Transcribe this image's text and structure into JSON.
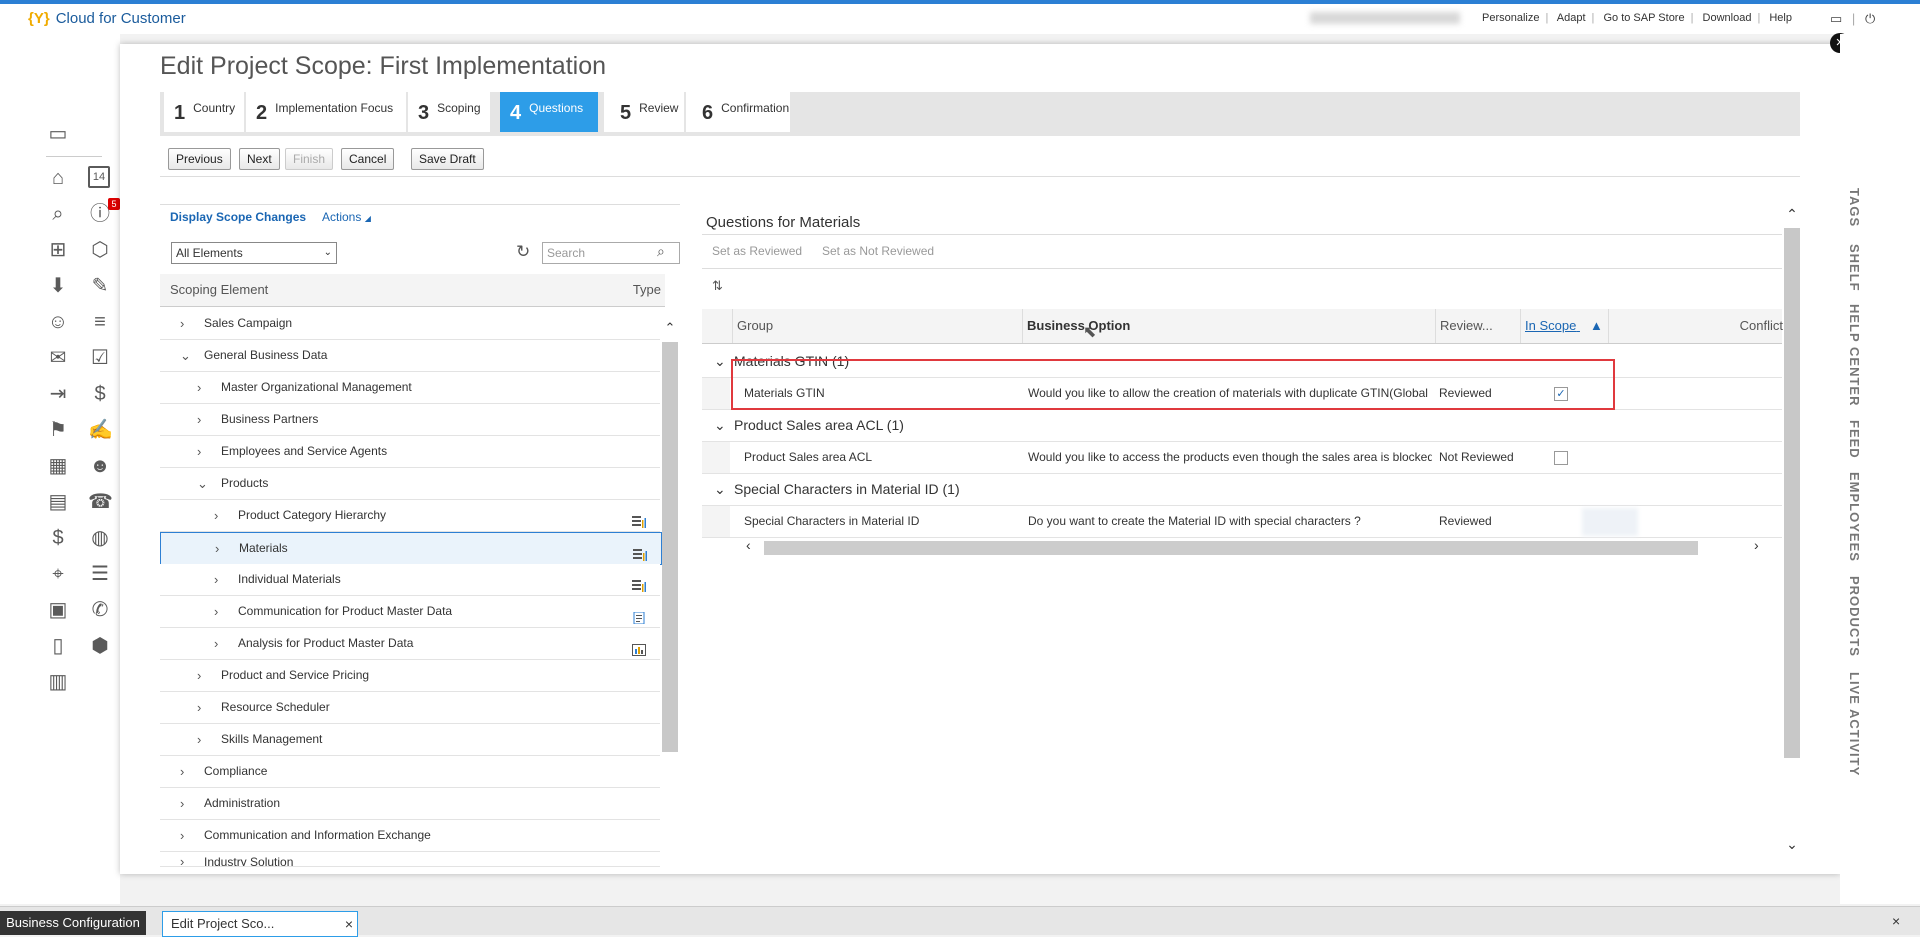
{
  "shell": {
    "brand": "Cloud for Customer",
    "links": [
      "Personalize",
      "Adapt",
      "Go to SAP Store",
      "Download",
      "Help"
    ]
  },
  "dialog": {
    "title": "Edit Project Scope: First Implementation",
    "steps": [
      {
        "num": "1",
        "label": "Country"
      },
      {
        "num": "2",
        "label": "Implementation Focus"
      },
      {
        "num": "3",
        "label": "Scoping"
      },
      {
        "num": "4",
        "label": "Questions"
      },
      {
        "num": "5",
        "label": "Review"
      },
      {
        "num": "6",
        "label": "Confirmation"
      }
    ],
    "toolbar": {
      "previous": "Previous",
      "next": "Next",
      "finish": "Finish",
      "cancel": "Cancel",
      "save_draft": "Save Draft"
    }
  },
  "left_panel": {
    "display_scope_changes": "Display Scope Changes",
    "actions": "Actions",
    "filter_value": "All Elements",
    "search_placeholder": "Search",
    "columns": {
      "element": "Scoping Element",
      "type": "Type"
    },
    "rows": [
      {
        "label": "Sales Campaign",
        "level": 0,
        "expanded": false
      },
      {
        "label": "General Business Data",
        "level": 0,
        "expanded": true
      },
      {
        "label": "Master Organizational Management",
        "level": 1,
        "expanded": false
      },
      {
        "label": "Business Partners",
        "level": 1,
        "expanded": false
      },
      {
        "label": "Employees and Service Agents",
        "level": 1,
        "expanded": false
      },
      {
        "label": "Products",
        "level": 1,
        "expanded": true
      },
      {
        "label": "Product Category Hierarchy",
        "level": 2,
        "expanded": false,
        "type_icon": "table-chart-icon"
      },
      {
        "label": "Materials",
        "level": 2,
        "expanded": false,
        "type_icon": "table-chart-icon",
        "selected": true
      },
      {
        "label": "Individual Materials",
        "level": 2,
        "expanded": false,
        "type_icon": "table-chart-icon"
      },
      {
        "label": "Communication for Product Master Data",
        "level": 2,
        "expanded": false,
        "type_icon": "document-icon"
      },
      {
        "label": "Analysis for Product Master Data",
        "level": 2,
        "expanded": false,
        "type_icon": "bar-chart-icon"
      },
      {
        "label": "Product and Service Pricing",
        "level": 1,
        "expanded": false
      },
      {
        "label": "Resource Scheduler",
        "level": 1,
        "expanded": false
      },
      {
        "label": "Skills Management",
        "level": 1,
        "expanded": false
      },
      {
        "label": "Compliance",
        "level": 0,
        "expanded": false
      },
      {
        "label": "Administration",
        "level": 0,
        "expanded": false
      },
      {
        "label": "Communication and Information Exchange",
        "level": 0,
        "expanded": false
      },
      {
        "label": "Industry Solution",
        "level": 0,
        "expanded": false
      }
    ]
  },
  "right_panel": {
    "title": "Questions for Materials",
    "set_reviewed": "Set as Reviewed",
    "set_not_reviewed": "Set as Not Reviewed",
    "columns": {
      "group": "Group",
      "business_option": "Business Option",
      "reviewed": "Review...",
      "in_scope": "In Scope",
      "conflict": "Conflict"
    },
    "groups": [
      {
        "label": "Materials GTIN (1)",
        "row": {
          "group": "Materials GTIN",
          "option": "Would you like to allow the creation of materials with duplicate GTIN(Global",
          "reviewed": "Reviewed",
          "in_scope": true
        }
      },
      {
        "label": "Product Sales area ACL (1)",
        "row": {
          "group": "Product Sales area ACL",
          "option": "Would you like to access the products even though the sales area is blocked",
          "reviewed": "Not Reviewed",
          "in_scope": false
        }
      },
      {
        "label": "Special Characters in Material ID (1)",
        "row": {
          "group": "Special Characters in Material ID",
          "option": "Do you want to create the Material ID with special characters ?",
          "reviewed": "Reviewed",
          "in_scope": null
        }
      }
    ]
  },
  "side_tabs": [
    "TAGS",
    "SHELF",
    "HELP CENTER",
    "FEED",
    "EMPLOYEES",
    "PRODUCTS",
    "LIVE ACTIVITY"
  ],
  "nav_badge": "5",
  "calendar_day": "14",
  "bottom_tabs": {
    "main": "Business Configuration",
    "current": "Edit Project Sco..."
  }
}
